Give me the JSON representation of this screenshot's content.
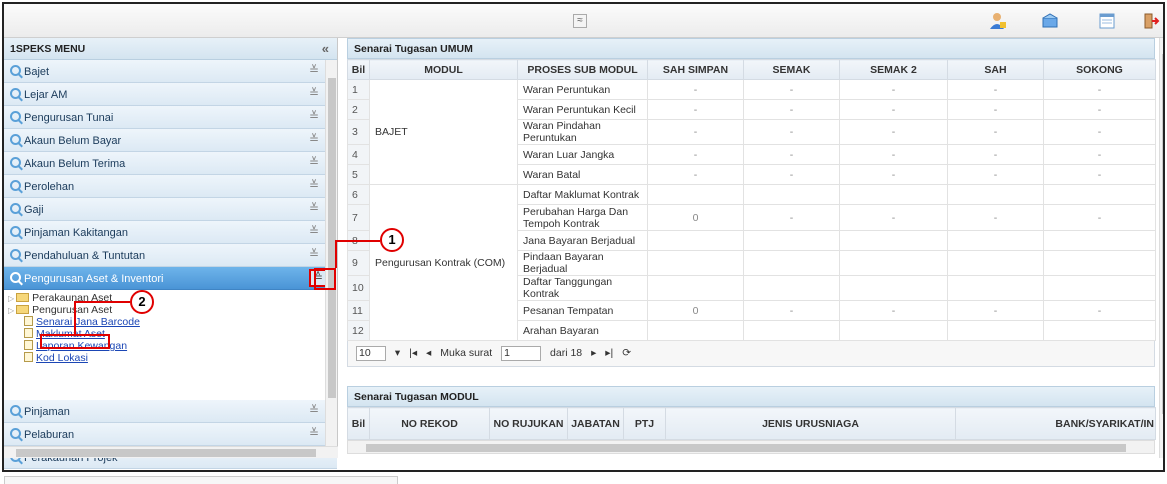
{
  "toolbar": {
    "collapse_symbol": "≈",
    "icons": [
      "user-icon",
      "inbox-icon",
      "calendar-icon",
      "logout-icon"
    ]
  },
  "sidebar": {
    "title": "1SPEKS MENU",
    "collapse_symbol": "«",
    "items": [
      {
        "label": "Bajet"
      },
      {
        "label": "Lejar AM"
      },
      {
        "label": "Pengurusan Tunai"
      },
      {
        "label": "Akaun Belum Bayar"
      },
      {
        "label": "Akaun Belum Terima"
      },
      {
        "label": "Perolehan"
      },
      {
        "label": "Gaji"
      },
      {
        "label": "Pinjaman Kakitangan"
      },
      {
        "label": "Pendahuluan & Tuntutan"
      },
      {
        "label": "Pengurusan Aset & Inventori"
      },
      {
        "label": "Pinjaman"
      },
      {
        "label": "Pelaburan"
      },
      {
        "label": "Perakaunan Projek"
      }
    ],
    "tree": {
      "folders": [
        "Perakaunan Aset",
        "Pengurusan Aset"
      ],
      "leaves": [
        "Senarai Jana Barcode",
        "Maklumat Aset",
        "Laporan Kewangan",
        "Kod Lokasi"
      ]
    }
  },
  "umum": {
    "title": "Senarai Tugasan UMUM",
    "headers": [
      "Bil",
      "MODUL",
      "PROSES SUB MODUL",
      "SAH SIMPAN",
      "SEMAK",
      "SEMAK 2",
      "SAH",
      "SOKONG"
    ],
    "modules": [
      "BAJET",
      "Pengurusan Kontrak (COM)"
    ],
    "rows": [
      {
        "bil": "1",
        "proses": "Waran Peruntukan",
        "sah_simpan": "-",
        "semak": "-",
        "semak2": "-",
        "sah": "-",
        "sokong": "-"
      },
      {
        "bil": "2",
        "proses": "Waran Peruntukan Kecil",
        "sah_simpan": "-",
        "semak": "-",
        "semak2": "-",
        "sah": "-",
        "sokong": "-"
      },
      {
        "bil": "3",
        "proses": "Waran Pindahan Peruntukan",
        "sah_simpan": "-",
        "semak": "-",
        "semak2": "-",
        "sah": "-",
        "sokong": "-"
      },
      {
        "bil": "4",
        "proses": "Waran Luar Jangka",
        "sah_simpan": "-",
        "semak": "-",
        "semak2": "-",
        "sah": "-",
        "sokong": "-"
      },
      {
        "bil": "5",
        "proses": "Waran Batal",
        "sah_simpan": "-",
        "semak": "-",
        "semak2": "-",
        "sah": "-",
        "sokong": "-"
      },
      {
        "bil": "6",
        "proses": "Daftar Maklumat Kontrak",
        "sah_simpan": "",
        "semak": "",
        "semak2": "",
        "sah": "",
        "sokong": ""
      },
      {
        "bil": "7",
        "proses": "Perubahan Harga Dan Tempoh Kontrak",
        "sah_simpan": "0",
        "semak": "-",
        "semak2": "-",
        "sah": "-",
        "sokong": "-"
      },
      {
        "bil": "8",
        "proses": "Jana Bayaran Berjadual",
        "sah_simpan": "",
        "semak": "",
        "semak2": "",
        "sah": "",
        "sokong": ""
      },
      {
        "bil": "9",
        "proses": "Pindaan Bayaran Berjadual",
        "sah_simpan": "",
        "semak": "",
        "semak2": "",
        "sah": "",
        "sokong": ""
      },
      {
        "bil": "10",
        "proses": "Daftar Tanggungan Kontrak",
        "sah_simpan": "",
        "semak": "",
        "semak2": "",
        "sah": "",
        "sokong": ""
      },
      {
        "bil": "11",
        "proses": "Pesanan Tempatan",
        "sah_simpan": "0",
        "semak": "-",
        "semak2": "-",
        "sah": "-",
        "sokong": "-"
      },
      {
        "bil": "12",
        "proses": "Arahan Bayaran",
        "sah_simpan": "",
        "semak": "",
        "semak2": "",
        "sah": "",
        "sokong": ""
      }
    ],
    "pager": {
      "page_size": "10",
      "page_label": "Muka surat",
      "page": "1",
      "of_label": "dari 18"
    }
  },
  "modul": {
    "title": "Senarai Tugasan MODUL",
    "headers": [
      "Bil",
      "NO REKOD",
      "NO RUJUKAN",
      "JABATAN",
      "PTJ",
      "JENIS URUSNIAGA",
      "BANK/SYARIKAT/IN"
    ]
  },
  "callouts": [
    "1",
    "2"
  ]
}
